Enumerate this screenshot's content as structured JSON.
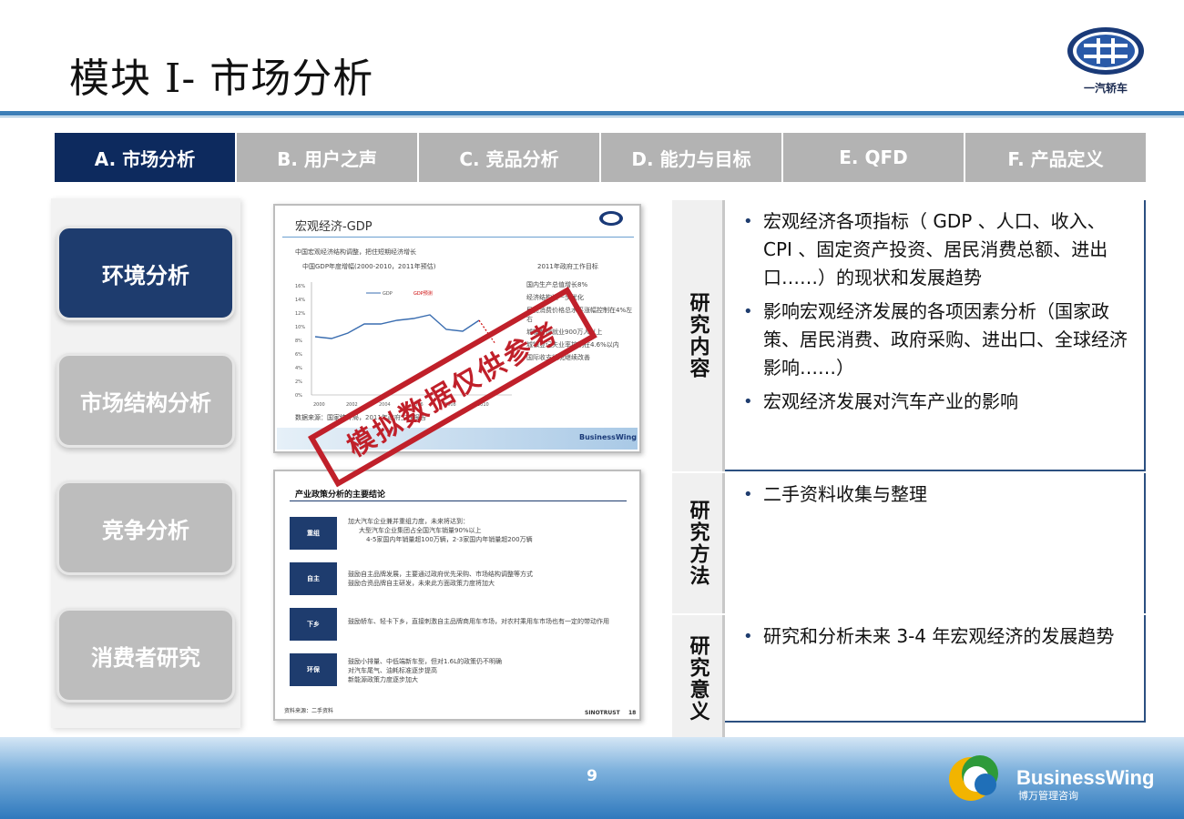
{
  "header": {
    "title": "模块 I- 市场分析",
    "logo_text": "一汽轿车"
  },
  "tabs": [
    {
      "label": "A. 市场分析",
      "active": true
    },
    {
      "label": "B. 用户之声",
      "active": false
    },
    {
      "label": "C. 竞品分析",
      "active": false
    },
    {
      "label": "D. 能力与目标",
      "active": false
    },
    {
      "label": "E. QFD",
      "active": false
    },
    {
      "label": "F. 产品定义",
      "active": false
    }
  ],
  "side_nav": [
    {
      "label": "环境分析",
      "active": true
    },
    {
      "label": "市场结构分析",
      "active": false
    },
    {
      "label": "竞争分析",
      "active": false
    },
    {
      "label": "消费者研究",
      "active": false
    }
  ],
  "thumb1": {
    "title": "宏观经济-GDP",
    "note": "中国宏观经济结构调整，把住短期经济增长",
    "chart_title": "中国GDP年度增幅(2000-2010，2011年预估)",
    "panel_title": "2011年政府工作目标",
    "legend": [
      "GDP",
      "GDP预测"
    ],
    "y_ticks": [
      "16%",
      "14%",
      "12%",
      "10%",
      "8%",
      "6%",
      "4%",
      "2%",
      "0%"
    ],
    "x_ticks": [
      "2000",
      "2002",
      "2004",
      "2006",
      "2008",
      "2010"
    ],
    "goals": [
      "国内生产总值增长8%",
      "经济结构进一步优化",
      "居民消费价格总水平涨幅控制在4%左右",
      "城镇新增就业900万人以上",
      "城镇登记失业率控制在4.6%以内",
      "国际收支状况继续改善"
    ],
    "source": "数据来源：国家统计局，2011年政府工作报告",
    "brand": "BusinessWing"
  },
  "thumb2": {
    "title": "产业政策分析的主要结论",
    "rows": [
      {
        "tag": "重组",
        "lines": [
          "加大汽车企业兼并重组力度，未来将达到：",
          "大型汽车企业集团占全国汽车销量90%以上",
          "4-5家国内年销量超100万辆，2-3家国内年销量超200万辆"
        ]
      },
      {
        "tag": "自主",
        "lines": [
          "鼓励自主品牌发展，主要通过政府优先采购、市场结构调整等方式",
          "鼓励合资品牌自主研发，未来此方面政策力度将加大"
        ]
      },
      {
        "tag": "下乡",
        "lines": [
          "鼓励轿车、轻卡下乡，直接刺激自主品牌商用车市场，对农村乘用车市场也有一定的带动作用"
        ]
      },
      {
        "tag": "环保",
        "lines": [
          "鼓励小排量、中低端新车型，但对1.6L的政策仍不明确",
          "对汽车尾气、油耗标准逐步提高",
          "新能源政策力度逐步加大"
        ]
      }
    ],
    "source": "资料来源：二手资料",
    "footer_brand": "SINOTRUST",
    "footer_num": "18"
  },
  "watermark": "模拟数据仅供参考",
  "sections": [
    {
      "label": "研究内容",
      "bullets": [
        "宏观经济各项指标（ GDP 、人口、收入、 CPI 、固定资产投资、居民消费总额、进出口……）的现状和发展趋势",
        "影响宏观经济发展的各项因素分析（国家政策、居民消费、政府采购、进出口、全球经济影响……）",
        "宏观经济发展对汽车产业的影响"
      ]
    },
    {
      "label": "研究方法",
      "bullets": [
        "二手资料收集与整理"
      ]
    },
    {
      "label": "研究意义",
      "bullets": [
        "研究和分析未来 3-4 年宏观经济的发展趋势"
      ]
    }
  ],
  "footer": {
    "page_number": "9",
    "brand": "BusinessWing",
    "brand_sub": "博万管理咨询"
  },
  "colors": {
    "active_tab": "#0d2a5e",
    "inactive_tab": "#b3b3b3",
    "rule": "#3d7fb8",
    "stamp": "#c0202a"
  }
}
